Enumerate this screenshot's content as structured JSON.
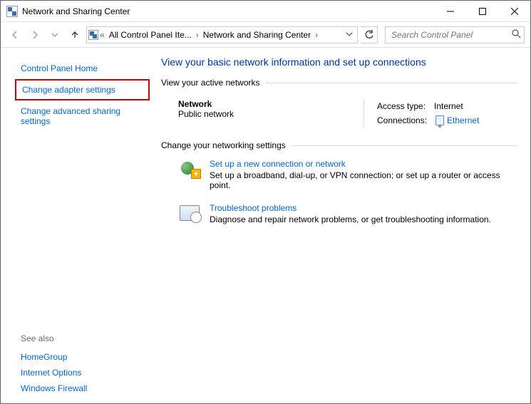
{
  "window": {
    "title": "Network and Sharing Center"
  },
  "breadcrumb": {
    "item1": "All Control Panel Ite...",
    "item2": "Network and Sharing Center"
  },
  "search": {
    "placeholder": "Search Control Panel"
  },
  "sidebar": {
    "home": "Control Panel Home",
    "change_adapter": "Change adapter settings",
    "change_advanced": "Change advanced sharing settings",
    "see_also_label": "See also",
    "homegroup": "HomeGroup",
    "internet_options": "Internet Options",
    "windows_firewall": "Windows Firewall"
  },
  "content": {
    "title": "View your basic network information and set up connections",
    "active_hdr": "View your active networks",
    "network_name": "Network",
    "network_type": "Public network",
    "access_label": "Access type:",
    "access_value": "Internet",
    "connections_label": "Connections:",
    "connections_value": "Ethernet",
    "settings_hdr": "Change your networking settings",
    "setup_link": "Set up a new connection or network",
    "setup_desc": "Set up a broadband, dial-up, or VPN connection; or set up a router or access point.",
    "trouble_link": "Troubleshoot problems",
    "trouble_desc": "Diagnose and repair network problems, or get troubleshooting information."
  }
}
